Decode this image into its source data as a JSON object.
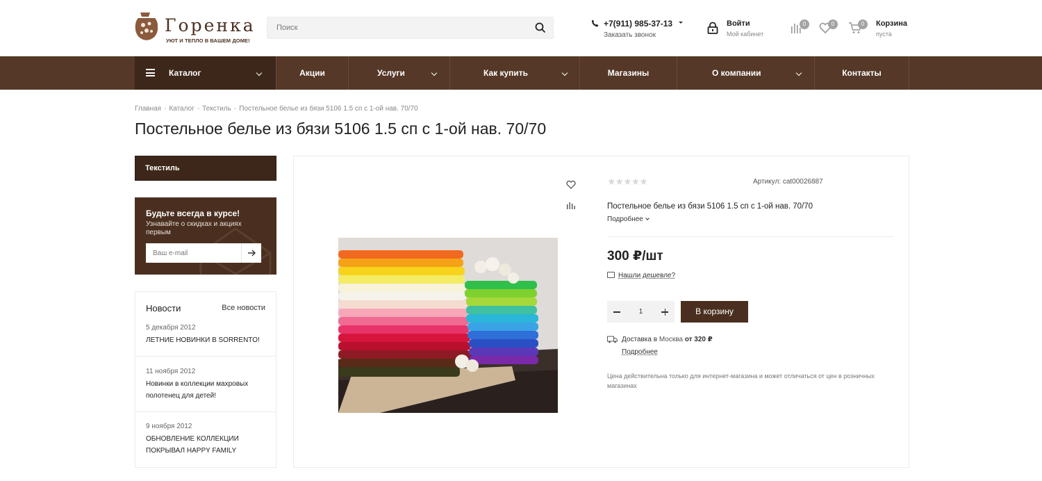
{
  "brand": {
    "name": "Горенка",
    "slogan": "УЮТ И ТЕПЛО В ВАШЕМ ДОМЕ!"
  },
  "search": {
    "placeholder": "Поиск"
  },
  "contacts": {
    "phone": "+7(911) 985-37-13",
    "callback": "Заказать звонок"
  },
  "account": {
    "login": "Войти",
    "cabinet": "Мой кабинет"
  },
  "counters": {
    "compare": "0",
    "favorites": "0",
    "cart": "0"
  },
  "cart": {
    "label": "Корзина",
    "status": "пуста"
  },
  "nav": {
    "catalog": "Каталог",
    "items": [
      "Акции",
      "Услуги",
      "Как купить",
      "Магазины",
      "О компании",
      "Контакты"
    ]
  },
  "breadcrumb": [
    "Главная",
    "Каталог",
    "Текстиль",
    "Постельное белье из бязи 5106 1.5 сп с 1-ой нав. 70/70"
  ],
  "page": {
    "title": "Постельное белье из бязи 5106 1.5 сп с 1-ой нав. 70/70"
  },
  "sidebar": {
    "category": "Текстиль",
    "subscribe": {
      "title": "Будьте всегда в курсе!",
      "text": "Узнавайте о скидках и акциях первым",
      "placeholder": "Ваш e-mail"
    },
    "news": {
      "title": "Новости",
      "all": "Все новости",
      "items": [
        {
          "date": "5 декабря 2012",
          "headline": "ЛЕТНИЕ НОВИНКИ В SORRENTO!"
        },
        {
          "date": "11 ноября 2012",
          "headline": "Новинки в коллекции махровых полотенец для детей!"
        },
        {
          "date": "9 ноября 2012",
          "headline": "ОБНОВЛЕНИЕ КОЛЛЕКЦИИ ПОКРЫВАЛ HAPPY FAMILY"
        }
      ]
    }
  },
  "product": {
    "rating": 0,
    "stars": "★★★★★",
    "sku": "Артикул: cat00026887",
    "name": "Постельное белье из бязи 5106 1.5 сп с 1-ой нав. 70/70",
    "more": "Подробнее",
    "price": "300 ₽/шт",
    "cheaper": "Нашли дешевле?",
    "quantity": "1",
    "add_to_cart": "В корзину",
    "delivery": {
      "prefix": "Доставка в",
      "city": "Москва",
      "from": "от 320 ₽",
      "more": "Подробнее"
    },
    "note": "Цена действительна только для интернет-магазина и может отличаться от цен в розничных магазинах"
  },
  "colors": {
    "brand_dark": "#3d271a",
    "brand": "#553827",
    "button": "#4a2f20"
  }
}
